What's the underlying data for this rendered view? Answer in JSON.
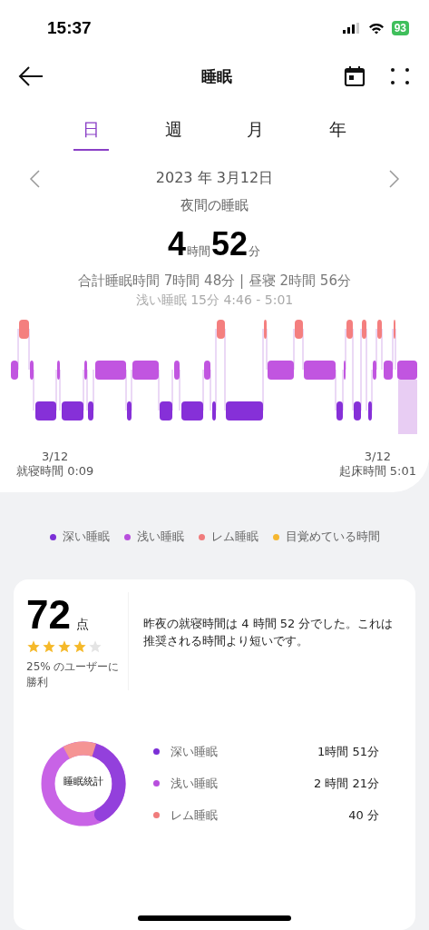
{
  "status_bar": {
    "time": "15:37",
    "battery": "93"
  },
  "header": {
    "title": "睡眠"
  },
  "tabs": [
    {
      "label": "日",
      "selected": true
    },
    {
      "label": "週",
      "selected": false
    },
    {
      "label": "月",
      "selected": false
    },
    {
      "label": "年",
      "selected": false
    }
  ],
  "date": "2023 年 3月12日",
  "section_title": "夜間の睡眠",
  "duration": {
    "hours": "4",
    "hours_unit": "時間",
    "minutes": "52",
    "minutes_unit": "分"
  },
  "summary": "合計睡眠時間 7時間 48分 | 昼寝 2時間 56分",
  "selection_info": "浅い睡眠 15分 4:46 - 5:01",
  "chart_start": {
    "date": "3/12",
    "label": "就寝時間 0:09"
  },
  "chart_end": {
    "date": "3/12",
    "label": "起床時間 5:01"
  },
  "legend": [
    {
      "label": "深い睡眠",
      "color": "#7b2fd6"
    },
    {
      "label": "浅い睡眠",
      "color": "#b84fdd"
    },
    {
      "label": "レム睡眠",
      "color": "#f07c7c"
    },
    {
      "label": "目覚めている時間",
      "color": "#f5b731"
    }
  ],
  "score": {
    "value": "72",
    "unit": "点",
    "stars": 4,
    "rank": "25% のユーザーに勝利",
    "comment": "昨夜の就寝時間は 4 時間 52 分でした。これは推奨される時間より短いです。"
  },
  "stats": {
    "center_label": "睡眠統計",
    "rows": [
      {
        "label": "深い睡眠",
        "value": "1時間 51分",
        "color": "#7b2fd6"
      },
      {
        "label": "浅い睡眠",
        "value": "2 時間 21分",
        "color": "#b84fdd"
      },
      {
        "label": "レム睡眠",
        "value": "40 分",
        "color": "#f07c7c"
      }
    ]
  }
}
